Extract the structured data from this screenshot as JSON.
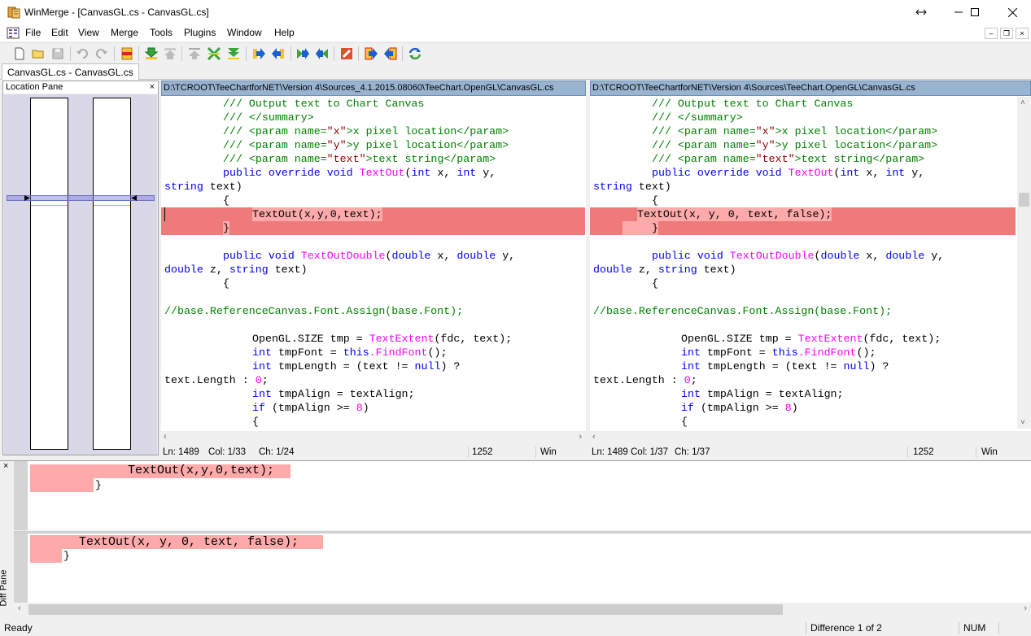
{
  "window": {
    "title": "WinMerge - [CanvasGL.cs - CanvasGL.cs]"
  },
  "menu": [
    "File",
    "Edit",
    "View",
    "Merge",
    "Tools",
    "Plugins",
    "Window",
    "Help"
  ],
  "tab": {
    "label": "CanvasGL.cs - CanvasGL.cs"
  },
  "location_pane": {
    "title": "Location Pane",
    "close": "×"
  },
  "left": {
    "path": "D:\\TCROOT\\TeeChartforNET\\Version 4\\Sources_4.1.2015.08060\\TeeChart.OpenGL\\CanvasGL.cs",
    "status": {
      "ln": "Ln: 1489",
      "col": "Col: 1/33",
      "ch": "Ch: 1/24",
      "enc": "1252",
      "eol": "Win"
    }
  },
  "right": {
    "path": "D:\\TCROOT\\TeeChartforNET\\Version 4\\Sources\\TeeChart.OpenGL\\CanvasGL.cs",
    "status": {
      "ln": "Ln: 1489",
      "col": "Col: 1/37",
      "ch": "Ch: 1/37",
      "enc": "1252",
      "eol": "Win"
    }
  },
  "code": {
    "l1": "/// Output text to Chart Canvas",
    "l2": "/// </summary>",
    "l3a": "/// <param name=",
    "l3b": "\"x\"",
    "l3c": ">x pixel location</param>",
    "l4b": "\"y\"",
    "l4c": ">y pixel location</param>",
    "l5b": "\"text\"",
    "l5c": ">text string</param>",
    "kw_public": "public",
    "kw_override": "override",
    "kw_void": "void",
    "fn_textout": "TextOut",
    "kw_int": "int",
    "x_comma": "x,",
    "y_comma": "y,",
    "kw_string": "string",
    "text_paren": "text)",
    "brace_open": "{",
    "brace_close": "}",
    "left_diff": "TextOut(x,y,0,text);",
    "right_diff": "TextOut(x, y, 0, text, false);",
    "fn_textoutdouble": "TextOutDouble",
    "paren": "(",
    "kw_double": "double",
    "z_comma": "z,",
    "comment_base": "//base.ReferenceCanvas.Font.Assign(base.Font);",
    "opengl_size": "OpenGL.SIZE tmp = ",
    "fn_textextent": "TextExtent",
    "textextent_args": "(fdc, text);",
    "tmpfont": "tmpFont = ",
    "kw_this": "this",
    "fn_findfont": ".FindFont",
    "call_end": "();",
    "tmplength": "tmpLength = (text != ",
    "kw_null": "null",
    "qmark": ") ?",
    "text_length": "text.Length",
    "colon": " : ",
    "zero": "0",
    "semicolon": ";",
    "tmpalign": "tmpAlign = textAlign;",
    "kw_if": "if",
    "if_cond": "(tmpAlign >= ",
    "eight": "8",
    "close_paren": ")"
  },
  "diff_pane": {
    "title": "Diff Pane",
    "close": "×",
    "top_line": "TextOut(x,y,0,text);",
    "top_brace": "}",
    "bottom_line": "TextOut(x, y, 0, text, false);",
    "bottom_brace": "}"
  },
  "status": {
    "ready": "Ready",
    "difference": "Difference 1 of 2",
    "num": "NUM"
  }
}
